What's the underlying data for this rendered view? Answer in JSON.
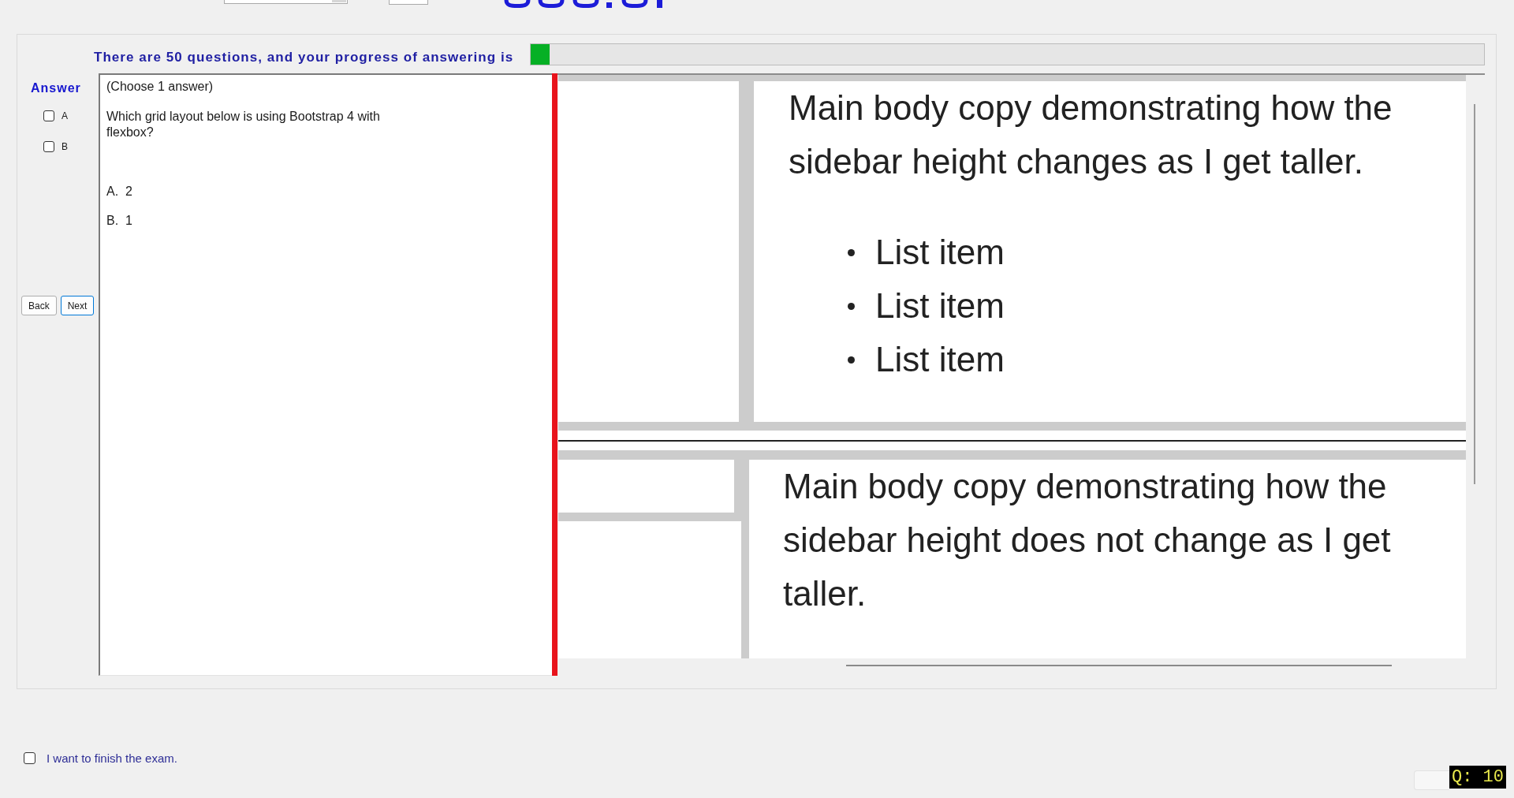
{
  "progress": {
    "text": "There are 50 questions, and your progress of answering is",
    "level": 0.02
  },
  "answer_panel": {
    "title": "Answer",
    "options": [
      {
        "label": "A",
        "checked": false
      },
      {
        "label": "B",
        "checked": false
      }
    ],
    "buttons": [
      {
        "label": "Back",
        "focused": false
      },
      {
        "label": "Next",
        "focused": true
      }
    ]
  },
  "question": {
    "instruction": "(Choose 1 answer)",
    "text": "Which grid layout below is using Bootstrap 4 with\nflexbox?",
    "choices": [
      "A.  2",
      "B.  1"
    ]
  },
  "figure": {
    "examples": [
      {
        "kind": "full_sidebar",
        "paragraph": "Main body copy demonstrating how the sidebar height changes as I get taller.",
        "list_items": [
          "List item",
          "List item",
          "List item"
        ]
      },
      {
        "kind": "split_sidebar",
        "paragraph": "Main body copy demonstrating how the sidebar height does not change as I get taller."
      }
    ]
  },
  "finish": {
    "label": "I want to finish the exam.",
    "checked": false
  },
  "question_number": "Q: 10"
}
